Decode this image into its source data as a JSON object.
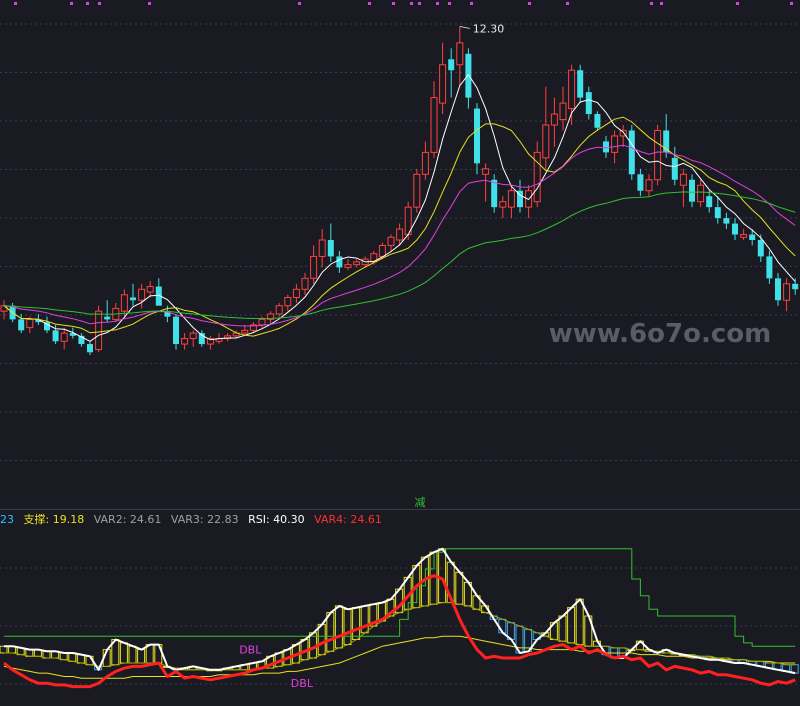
{
  "chart_data": [
    {
      "type": "candlestick",
      "panel": "price",
      "ylim": [
        4.2,
        12.6
      ],
      "high_label": "12.30",
      "signal_label": "减",
      "watermark": "www.6o7o.com",
      "moving_averages": [
        {
          "name": "MA5",
          "color": "#ffffff"
        },
        {
          "name": "MA10",
          "color": "#e8e020"
        },
        {
          "name": "MA20",
          "color": "#e040e0"
        },
        {
          "name": "MA60",
          "color": "#30c030"
        }
      ],
      "candles": [
        [
          7.1,
          7.3,
          6.95,
          7.2
        ],
        [
          7.2,
          7.25,
          6.9,
          6.95
        ],
        [
          6.95,
          7.05,
          6.7,
          6.75
        ],
        [
          6.8,
          7.0,
          6.7,
          6.95
        ],
        [
          6.95,
          7.05,
          6.85,
          6.9
        ],
        [
          6.9,
          7.0,
          6.7,
          6.75
        ],
        [
          6.75,
          6.85,
          6.5,
          6.55
        ],
        [
          6.55,
          6.8,
          6.4,
          6.7
        ],
        [
          6.7,
          6.8,
          6.6,
          6.65
        ],
        [
          6.65,
          6.7,
          6.45,
          6.5
        ],
        [
          6.5,
          6.55,
          6.3,
          6.35
        ],
        [
          6.4,
          7.2,
          6.35,
          7.1
        ],
        [
          7.0,
          7.3,
          6.9,
          6.95
        ],
        [
          6.95,
          7.25,
          6.9,
          7.15
        ],
        [
          7.1,
          7.5,
          7.0,
          7.4
        ],
        [
          7.35,
          7.6,
          7.2,
          7.3
        ],
        [
          7.3,
          7.6,
          7.15,
          7.5
        ],
        [
          7.45,
          7.65,
          7.35,
          7.55
        ],
        [
          7.55,
          7.7,
          7.4,
          7.2
        ],
        [
          7.1,
          7.2,
          6.9,
          7.0
        ],
        [
          7.0,
          7.05,
          6.4,
          6.5
        ],
        [
          6.5,
          6.7,
          6.4,
          6.6
        ],
        [
          6.6,
          6.75,
          6.45,
          6.7
        ],
        [
          6.7,
          6.75,
          6.45,
          6.5
        ],
        [
          6.5,
          6.65,
          6.4,
          6.6
        ],
        [
          6.55,
          6.7,
          6.5,
          6.6
        ],
        [
          6.6,
          6.7,
          6.55,
          6.65
        ],
        [
          6.65,
          6.75,
          6.6,
          6.7
        ],
        [
          6.7,
          6.85,
          6.65,
          6.75
        ],
        [
          6.75,
          6.9,
          6.7,
          6.85
        ],
        [
          6.85,
          7.0,
          6.8,
          6.95
        ],
        [
          6.95,
          7.1,
          6.85,
          7.05
        ],
        [
          7.05,
          7.25,
          7.0,
          7.2
        ],
        [
          7.2,
          7.4,
          7.1,
          7.35
        ],
        [
          7.35,
          7.6,
          7.25,
          7.5
        ],
        [
          7.5,
          7.8,
          7.4,
          7.7
        ],
        [
          7.7,
          8.3,
          7.6,
          8.1
        ],
        [
          8.1,
          8.6,
          7.9,
          8.4
        ],
        [
          8.4,
          8.7,
          8.0,
          8.1
        ],
        [
          8.1,
          8.2,
          7.8,
          7.9
        ],
        [
          7.9,
          8.05,
          7.85,
          7.95
        ],
        [
          7.95,
          8.05,
          7.9,
          8.0
        ],
        [
          7.95,
          8.1,
          7.9,
          8.05
        ],
        [
          8.0,
          8.2,
          7.95,
          8.15
        ],
        [
          8.1,
          8.35,
          8.05,
          8.3
        ],
        [
          8.3,
          8.5,
          8.2,
          8.45
        ],
        [
          8.4,
          8.7,
          8.3,
          8.6
        ],
        [
          8.5,
          9.1,
          8.4,
          9.0
        ],
        [
          9.0,
          9.7,
          8.9,
          9.6
        ],
        [
          9.6,
          10.2,
          9.5,
          10.0
        ],
        [
          10.0,
          11.3,
          9.9,
          11.0
        ],
        [
          10.9,
          12.0,
          10.7,
          11.6
        ],
        [
          11.7,
          11.9,
          11.0,
          11.5
        ],
        [
          11.6,
          12.3,
          11.2,
          12.0
        ],
        [
          11.8,
          11.9,
          10.8,
          11.0
        ],
        [
          10.8,
          10.9,
          9.6,
          9.8
        ],
        [
          9.6,
          9.8,
          9.1,
          9.7
        ],
        [
          9.5,
          9.6,
          8.9,
          9.0
        ],
        [
          9.0,
          9.2,
          8.8,
          9.1
        ],
        [
          9.0,
          9.4,
          8.8,
          9.3
        ],
        [
          9.3,
          9.5,
          8.9,
          9.0
        ],
        [
          9.0,
          9.4,
          8.8,
          9.3
        ],
        [
          9.1,
          10.2,
          9.0,
          10.0
        ],
        [
          9.9,
          11.2,
          9.7,
          10.5
        ],
        [
          10.5,
          11.0,
          10.1,
          10.7
        ],
        [
          10.6,
          11.2,
          10.4,
          10.9
        ],
        [
          10.8,
          11.6,
          10.5,
          11.5
        ],
        [
          11.5,
          11.6,
          10.9,
          11.0
        ],
        [
          11.1,
          11.2,
          10.6,
          10.7
        ],
        [
          10.7,
          10.75,
          10.4,
          10.45
        ],
        [
          10.2,
          10.3,
          9.9,
          10.0
        ],
        [
          10.0,
          10.4,
          9.8,
          10.3
        ],
        [
          10.3,
          10.5,
          10.1,
          10.4
        ],
        [
          10.4,
          10.5,
          9.5,
          9.6
        ],
        [
          9.6,
          9.7,
          9.2,
          9.3
        ],
        [
          9.3,
          9.6,
          9.2,
          9.5
        ],
        [
          9.5,
          10.5,
          9.4,
          10.4
        ],
        [
          10.4,
          10.7,
          9.9,
          10.0
        ],
        [
          9.9,
          10.1,
          9.4,
          9.5
        ],
        [
          9.4,
          9.7,
          9.0,
          9.6
        ],
        [
          9.5,
          9.6,
          9.0,
          9.1
        ],
        [
          9.1,
          9.5,
          9.0,
          9.4
        ],
        [
          9.2,
          9.3,
          8.9,
          9.0
        ],
        [
          9.0,
          9.2,
          8.7,
          8.8
        ],
        [
          8.8,
          8.9,
          8.6,
          8.7
        ],
        [
          8.7,
          8.8,
          8.4,
          8.5
        ],
        [
          8.45,
          8.6,
          8.4,
          8.5
        ],
        [
          8.5,
          8.6,
          8.3,
          8.4
        ],
        [
          8.4,
          8.5,
          8.0,
          8.1
        ],
        [
          8.1,
          8.2,
          7.6,
          7.7
        ],
        [
          7.7,
          7.8,
          7.2,
          7.3
        ],
        [
          7.3,
          7.7,
          7.1,
          7.6
        ],
        [
          7.6,
          7.7,
          7.4,
          7.5
        ]
      ]
    },
    {
      "type": "line",
      "panel": "indicator",
      "ylim": [
        0,
        100
      ],
      "header": [
        {
          "text": "23",
          "color": "#30c0ff"
        },
        {
          "text": "支撑: 19.18",
          "color": "#e8e020"
        },
        {
          "text": "VAR2: 24.61",
          "color": "#a0a0a0"
        },
        {
          "text": "VAR3: 22.83",
          "color": "#a0a0a0"
        },
        {
          "text": "RSI: 40.30",
          "color": "#ffffff"
        },
        {
          "text": "VAR4: 24.61",
          "color": "#ff3030"
        }
      ],
      "annotations": [
        {
          "text": "DBL",
          "color": "#e040e0",
          "at_index": 27,
          "value": 30
        },
        {
          "text": "DBL",
          "color": "#e040e0",
          "at_index": 33,
          "value": 10
        }
      ],
      "series": [
        {
          "key": "rsi",
          "color": "#ffffff",
          "values": [
            32,
            32,
            31,
            30,
            30,
            29,
            29,
            28,
            28,
            27,
            26,
            18,
            30,
            36,
            34,
            32,
            30,
            33,
            33,
            20,
            18,
            19,
            20,
            19,
            18,
            18,
            19,
            20,
            21,
            22,
            23,
            26,
            28,
            30,
            33,
            36,
            40,
            45,
            52,
            56,
            54,
            55,
            56,
            57,
            58,
            60,
            66,
            73,
            80,
            85,
            88,
            90,
            82,
            76,
            70,
            62,
            56,
            48,
            40,
            36,
            28,
            29,
            36,
            40,
            46,
            50,
            55,
            60,
            50,
            35,
            27,
            25,
            25,
            30,
            35,
            30,
            28,
            30,
            28,
            27,
            26,
            25,
            24,
            24,
            23,
            22,
            22,
            21,
            20,
            19,
            18,
            17,
            16
          ]
        },
        {
          "key": "var4",
          "color": "#ff2020",
          "values": [
            22,
            18,
            15,
            12,
            10,
            10,
            9,
            9,
            8,
            8,
            8,
            10,
            14,
            17,
            19,
            20,
            20,
            21,
            22,
            14,
            17,
            13,
            14,
            13,
            12,
            13,
            14,
            15,
            16,
            18,
            19,
            21,
            23,
            25,
            27,
            29,
            31,
            34,
            36,
            38,
            40,
            42,
            44,
            46,
            48,
            52,
            56,
            62,
            68,
            72,
            74,
            72,
            60,
            48,
            38,
            30,
            25,
            26,
            25,
            25,
            25,
            27,
            28,
            30,
            32,
            33,
            30,
            32,
            28,
            30,
            27,
            25,
            26,
            24,
            25,
            20,
            22,
            18,
            20,
            19,
            18,
            16,
            17,
            15,
            15,
            14,
            13,
            12,
            10,
            9,
            11,
            10,
            12
          ]
        },
        {
          "key": "var2",
          "color": "#a0a000",
          "values": [
            28,
            28,
            27,
            26,
            26,
            25,
            25,
            24,
            23,
            22,
            21,
            20,
            20,
            21,
            22,
            22,
            22,
            22,
            22,
            20,
            19,
            18,
            18,
            18,
            18,
            18,
            18,
            18,
            18,
            18,
            19,
            19,
            20,
            21,
            22,
            24,
            25,
            27,
            29,
            31,
            33,
            36,
            40,
            44,
            47,
            50,
            52,
            54,
            55,
            56,
            57,
            58,
            58,
            57,
            56,
            54,
            52,
            50,
            48,
            46,
            44,
            42,
            40,
            38,
            36,
            35,
            34,
            33,
            32,
            32,
            32,
            31,
            31,
            30,
            30,
            29,
            29,
            28,
            28,
            27,
            27,
            26,
            26,
            25,
            25,
            24,
            24,
            23,
            23,
            22,
            22,
            21,
            21
          ]
        },
        {
          "key": "support",
          "color": "#e8e020",
          "values": [
            20,
            19,
            18,
            17,
            16,
            16,
            15,
            14,
            14,
            13,
            13,
            13,
            13,
            13,
            13,
            14,
            14,
            14,
            14,
            14,
            14,
            14,
            14,
            14,
            14,
            15,
            15,
            15,
            15,
            15,
            16,
            16,
            16,
            17,
            17,
            18,
            19,
            20,
            21,
            22,
            24,
            26,
            28,
            30,
            32,
            33,
            34,
            35,
            36,
            37,
            37,
            38,
            38,
            38,
            37,
            36,
            35,
            34,
            33,
            32,
            31,
            31,
            30,
            30,
            30,
            30,
            30,
            29,
            29,
            29,
            28,
            28,
            28,
            28,
            27,
            27,
            27,
            26,
            26,
            26,
            25,
            25,
            25,
            25,
            24,
            24,
            24,
            23,
            23,
            23,
            22,
            22,
            22
          ]
        },
        {
          "key": "band_upper",
          "color": "#30c030",
          "values": [
            38,
            38,
            38,
            38,
            38,
            38,
            38,
            38,
            38,
            38,
            38,
            38,
            38,
            38,
            38,
            38,
            38,
            38,
            38,
            38,
            38,
            38,
            38,
            38,
            38,
            38,
            38,
            38,
            38,
            38,
            38,
            38,
            38,
            38,
            38,
            38,
            38,
            38,
            38,
            38,
            38,
            38,
            38,
            38,
            38,
            38,
            48,
            58,
            68,
            78,
            88,
            90,
            90,
            90,
            90,
            90,
            90,
            90,
            90,
            90,
            90,
            90,
            90,
            90,
            90,
            90,
            90,
            90,
            90,
            90,
            90,
            90,
            90,
            72,
            62,
            54,
            50,
            50,
            50,
            50,
            50,
            50,
            50,
            50,
            50,
            38,
            34,
            32,
            32,
            32,
            32,
            32,
            32
          ]
        }
      ]
    }
  ]
}
